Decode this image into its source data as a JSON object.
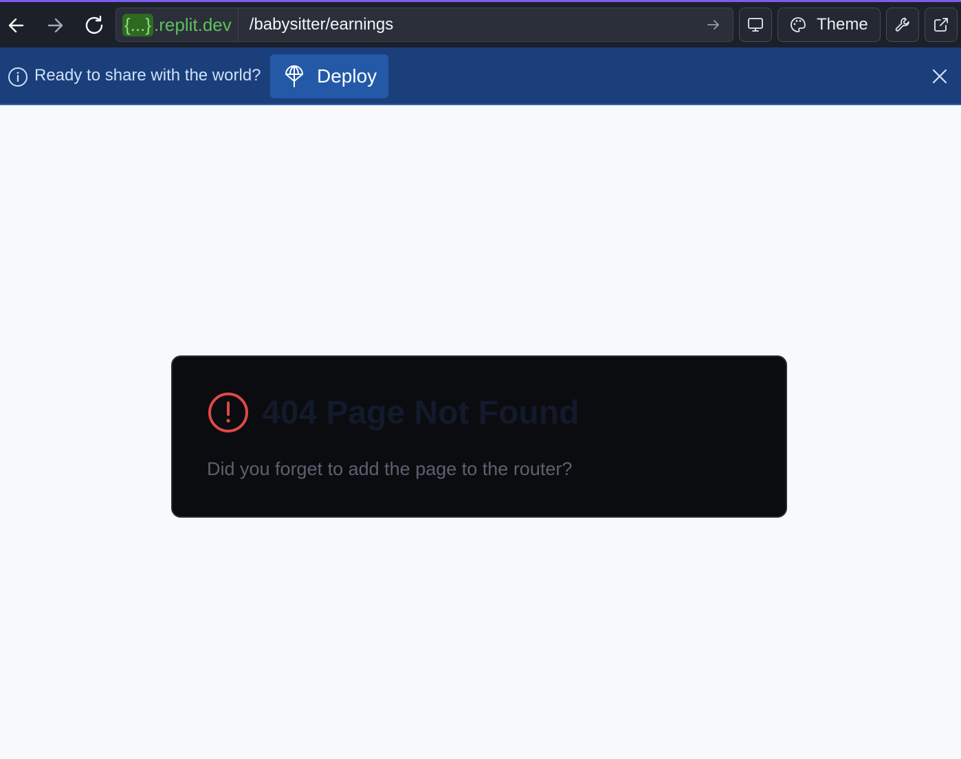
{
  "browser": {
    "url_domain_prefix": "{...}",
    "url_domain_suffix": ".replit.dev",
    "url_path": "/babysitter/earnings",
    "theme_label": "Theme"
  },
  "banner": {
    "message": "Ready to share with the world?",
    "deploy_label": "Deploy"
  },
  "error_card": {
    "title": "404 Page Not Found",
    "description": "Did you forget to add the page to the router?"
  },
  "colors": {
    "accent_line": "#7a5cf0",
    "banner_bg": "#1a3f7a",
    "deploy_button": "#2459a8",
    "error_icon": "#e04848",
    "domain_green": "#5fc05a"
  },
  "icons": [
    "back-arrow-icon",
    "forward-arrow-icon",
    "reload-icon",
    "go-arrow-icon",
    "monitor-icon",
    "palette-icon",
    "wrench-icon",
    "external-link-icon",
    "info-icon",
    "deploy-icon",
    "close-icon",
    "alert-circle-icon"
  ]
}
